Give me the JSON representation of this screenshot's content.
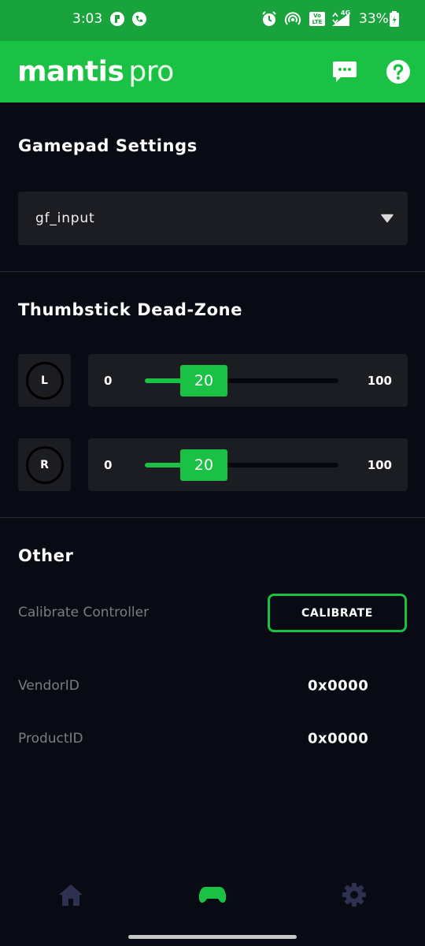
{
  "status_bar": {
    "time": "3:03",
    "icons": [
      "app-notification-icon",
      "call-icon",
      "alarm-icon",
      "hotspot-icon",
      "volte-icon",
      "signal-4g-icon",
      "battery-icon"
    ],
    "network": "4G",
    "volte_label": "Vo LTE",
    "battery": "33%"
  },
  "app_bar": {
    "title_main": "mantis",
    "title_sub": "pro",
    "actions": [
      "chat-icon",
      "help-icon"
    ]
  },
  "gamepad": {
    "title": "Gamepad Settings",
    "selected_input": "gf_input"
  },
  "deadzone": {
    "title": "Thumbstick Dead-Zone",
    "left": {
      "stick_label": "L",
      "min": "0",
      "max": "100",
      "value": "20"
    },
    "right": {
      "stick_label": "R",
      "min": "0",
      "max": "100",
      "value": "20"
    }
  },
  "other": {
    "title": "Other",
    "calibrate_label": "Calibrate Controller",
    "calibrate_button": "CALIBRATE",
    "vendor_label": "VendorID",
    "vendor_value": "0x0000",
    "product_label": "ProductID",
    "product_value": "0x0000"
  },
  "bottom_nav": {
    "items": [
      "home-icon",
      "gamepad-icon",
      "settings-icon"
    ],
    "active": "gamepad-icon"
  },
  "colors": {
    "accent": "#1bc144",
    "status_bar": "#19a33c",
    "background": "#080a14",
    "card": "#1b1d23",
    "nav_inactive": "#2d3150"
  }
}
